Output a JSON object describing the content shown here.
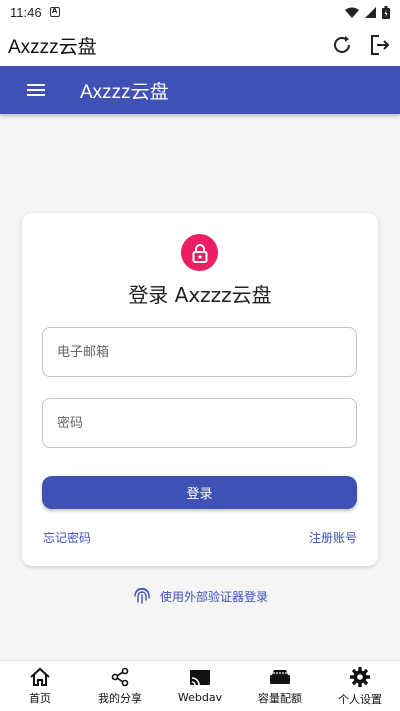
{
  "status_bar": {
    "time": "11:46",
    "notification_letter": "A"
  },
  "title_bar": {
    "title": "Axzzz云盘"
  },
  "app_bar": {
    "title": "Axzzz云盘"
  },
  "login_card": {
    "heading": "登录 Axzzz云盘",
    "email_placeholder": "电子邮箱",
    "password_placeholder": "密码",
    "login_button": "登录",
    "forgot_password": "忘记密码",
    "register": "注册账号"
  },
  "external_login": "使用外部验证器登录",
  "bottom_nav": [
    {
      "label": "首页",
      "icon": "home-icon"
    },
    {
      "label": "我的分享",
      "icon": "share-icon"
    },
    {
      "label": "Webdav",
      "icon": "cast-icon"
    },
    {
      "label": "容量配额",
      "icon": "storage-icon"
    },
    {
      "label": "个人设置",
      "icon": "gear-icon"
    }
  ],
  "colors": {
    "primary": "#3f51b5",
    "accent": "#e91e63"
  }
}
